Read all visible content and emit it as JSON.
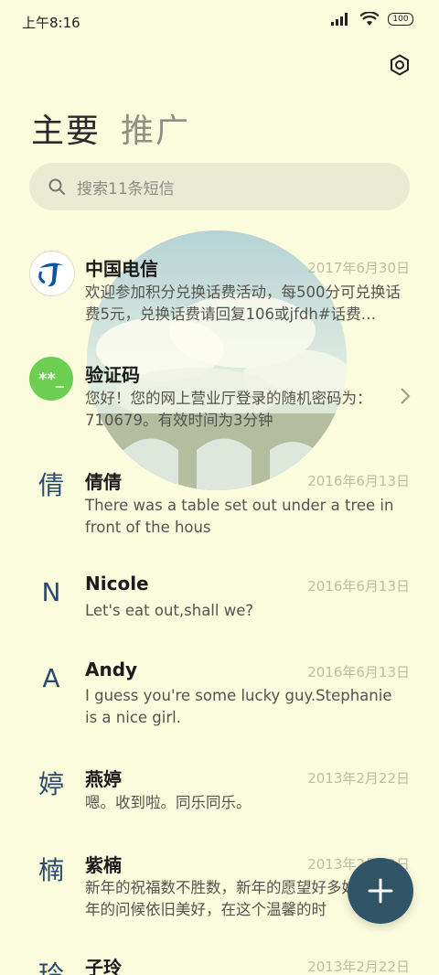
{
  "status_bar": {
    "time": "上午8:16",
    "battery": "100"
  },
  "tabs": [
    {
      "label": "主要"
    },
    {
      "label": "推广"
    }
  ],
  "search": {
    "placeholder": "搜索11条短信"
  },
  "messages": [
    {
      "name": "中国电信",
      "date": "2017年6月30日",
      "preview": "欢迎参加积分兑换话费活动，每500分可兑换话费5元，兑换话费请回复106或jfdh#话费…",
      "avatar_type": "telecom-logo"
    },
    {
      "name": "验证码",
      "date": "",
      "preview": "您好！您的网上营业厅登录的随机密码为：710679。有效时间为3分钟",
      "avatar_type": "code",
      "avatar_text": "**_"
    },
    {
      "name": "倩倩",
      "date": "2016年6月13日",
      "preview": "There was a table set out under a tree in front of the hous",
      "avatar_letter": "倩"
    },
    {
      "name": "Nicole",
      "date": "2016年6月13日",
      "preview": "Let's eat out,shall we?",
      "avatar_letter": "N"
    },
    {
      "name": "Andy",
      "date": "2016年6月13日",
      "preview": "I guess you're some lucky guy.Stephanie is a nice girl.",
      "avatar_letter": "A"
    },
    {
      "name": "燕婷",
      "date": "2013年2月22日",
      "preview": "嗯。收到啦。同乐同乐。",
      "avatar_letter": "婷"
    },
    {
      "name": "紫楠",
      "date": "2013年2月22日",
      "preview": "新年的祝福数不胜数，新年的愿望好多好多，新年的问候依旧美好，在这个温馨的时",
      "avatar_letter": "楠"
    },
    {
      "name": "子玲",
      "date": "2013年2月22日",
      "preview": "",
      "avatar_letter": "玲"
    }
  ],
  "colors": {
    "background": "#fbfbde",
    "fab": "#2f5566",
    "verify_avatar": "#6ccf52",
    "telecom_blue": "#0c55a6"
  },
  "icons": {
    "settings": "gear-icon",
    "search": "search-icon",
    "fab": "plus-icon"
  }
}
